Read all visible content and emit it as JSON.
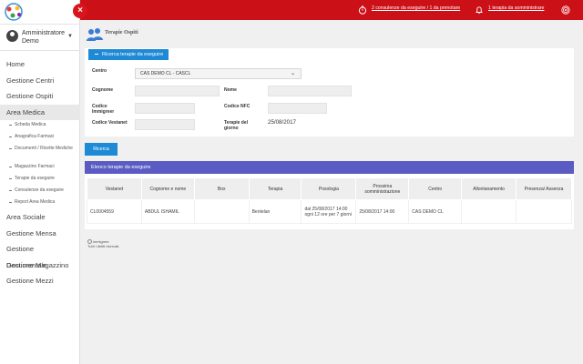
{
  "app": {
    "close_label": "×"
  },
  "user": {
    "name": "Amministratore Demo"
  },
  "menu": {
    "home": "Home",
    "gestione_centri": "Gestione Centri",
    "gestione_ospiti": "Gestione Ospiti",
    "area_medica": "Area Medica",
    "area_medica_items": [
      "Scheda Medica",
      "Anagrafica Farmaci",
      "Documenti / Ricette Mediche",
      "Magazzino Farmaci",
      "Terapie da eseguire",
      "Consulenze da eseguire",
      "Report Area Medica"
    ],
    "area_sociale": "Area Sociale",
    "gestione_mensa": "Gestione Mensa",
    "gestione_documentale": "Gestione Documentale",
    "gestione_magazzino": "Gestione Magazzino",
    "gestione_mezzi": "Gestione Mezzi"
  },
  "topbar": {
    "consulenze": "2 consulenze da eseguire / 1 da prenotare",
    "terapia": "1 terapia da somministrare"
  },
  "page": {
    "title": "Terapie Ospiti"
  },
  "search": {
    "toggle_label": "Ricerca terapie da eseguire",
    "centro_label": "Centro",
    "centro_value": "CAS DEMO CL - CASCL",
    "cognome_label": "Cognome",
    "nome_label": "Nome",
    "codice_immigreer_label": "Codice Immigreer",
    "codice_nfc_label": "Codice NFC",
    "codice_vestanet_label": "Codice Vestanet",
    "terapie_giorno_label": "Terapie del giorno",
    "terapie_giorno_value": "25/08/2017",
    "submit_label": "Ricerca"
  },
  "list": {
    "title": "Elenco terapie da eseguire",
    "columns": [
      "Vestanet",
      "Cognome e nome",
      "Box",
      "Terapia",
      "Posologia",
      "Prossima somministrazione",
      "Centro",
      "Allontanamento",
      "Presenza/ Assenza"
    ],
    "rows": [
      [
        "CL0004559",
        "ABDUL ISHAMIL",
        "",
        "Bentelan",
        "dal 25/08/2017 14:00 ogni 12 ore per 7 giorni",
        "25/08/2017 14:00",
        "CAS DEMO CL",
        "",
        ""
      ]
    ]
  },
  "footer": {
    "brand": "immigreer",
    "rights": "Tutti i diritti riservati."
  }
}
